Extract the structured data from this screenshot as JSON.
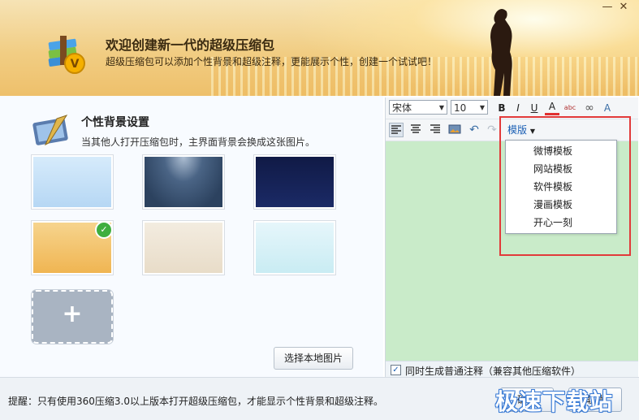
{
  "header": {
    "title": "欢迎创建新一代的超级压缩包",
    "subtitle": "超级压缩包可以添加个性背景和超级注释，更能展示个性，创建一个试试吧！",
    "minimize_glyph": "—",
    "close_glyph": "✕"
  },
  "background": {
    "title": "个性背景设置",
    "description": "当其他人打开压缩包时，主界面背景会换成这张图片。",
    "thumbnails": [
      {
        "name": "light-blue",
        "selected": false
      },
      {
        "name": "night-blue",
        "selected": false
      },
      {
        "name": "dark-navy-night",
        "selected": false
      },
      {
        "name": "orange-sunset",
        "selected": true
      },
      {
        "name": "beige-sketch",
        "selected": false
      },
      {
        "name": "light-cyan-illustration",
        "selected": false
      }
    ],
    "add_glyph": "+",
    "local_image_button": "选择本地图片"
  },
  "editor": {
    "font_name": "宋体",
    "font_size": "10",
    "toolbar": {
      "bold": "B",
      "italic": "I",
      "underline": "U",
      "font_color": "A",
      "spellcheck": "abc",
      "link": "∞",
      "clear_format": "A"
    },
    "template_label": "模版",
    "template_items": [
      "微博模板",
      "网站模板",
      "软件模板",
      "漫画模板",
      "开心一刻"
    ],
    "also_plain_note_label": "同时生成普通注释（兼容其他压缩软件）",
    "also_plain_note_checked": true
  },
  "footer": {
    "tip": "提醒：只有使用360压缩3.0以上版本打开超级压缩包，才能显示个性背景和超级注释。",
    "confirm_button": "确定",
    "cancel_button": "取消",
    "watermark": "极速下载站"
  },
  "colors": {
    "accent": "#1a5fb4",
    "editor_bg": "#c9ebc9",
    "highlight": "#e23a3a",
    "check_green": "#3fae3f"
  }
}
